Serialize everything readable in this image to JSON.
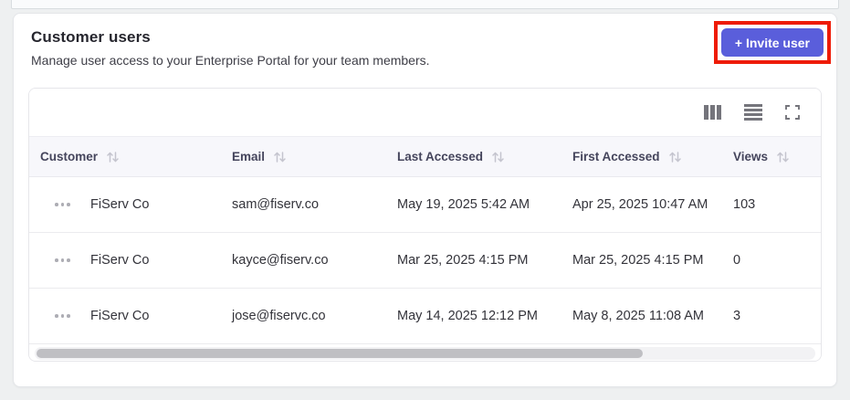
{
  "card": {
    "title": "Customer users",
    "subtitle": "Manage user access to your Enterprise Portal for your team members.",
    "invite_button_label": "+ Invite user",
    "accent_color": "#5a5edb",
    "annotation_color": "#ee1b07"
  },
  "table": {
    "toolbar_icons": [
      "columns-icon",
      "row-density-icon",
      "fullscreen-icon"
    ],
    "columns": [
      {
        "label": "Customer",
        "sortable": true
      },
      {
        "label": "Email",
        "sortable": true
      },
      {
        "label": "Last Accessed",
        "sortable": true
      },
      {
        "label": "First Accessed",
        "sortable": true
      },
      {
        "label": "Views",
        "sortable": true
      }
    ],
    "rows": [
      {
        "customer": "FiServ Co",
        "email": "sam@fiserv.co",
        "last_accessed": "May 19, 2025 5:42 AM",
        "first_accessed": "Apr 25, 2025 10:47 AM",
        "views": "103"
      },
      {
        "customer": "FiServ Co",
        "email": "kayce@fiserv.co",
        "last_accessed": "Mar 25, 2025 4:15 PM",
        "first_accessed": "Mar 25, 2025 4:15 PM",
        "views": "0"
      },
      {
        "customer": "FiServ Co",
        "email": "jose@fiservc.co",
        "last_accessed": "May 14, 2025 12:12 PM",
        "first_accessed": "May 8, 2025 11:08 AM",
        "views": "3"
      }
    ]
  }
}
